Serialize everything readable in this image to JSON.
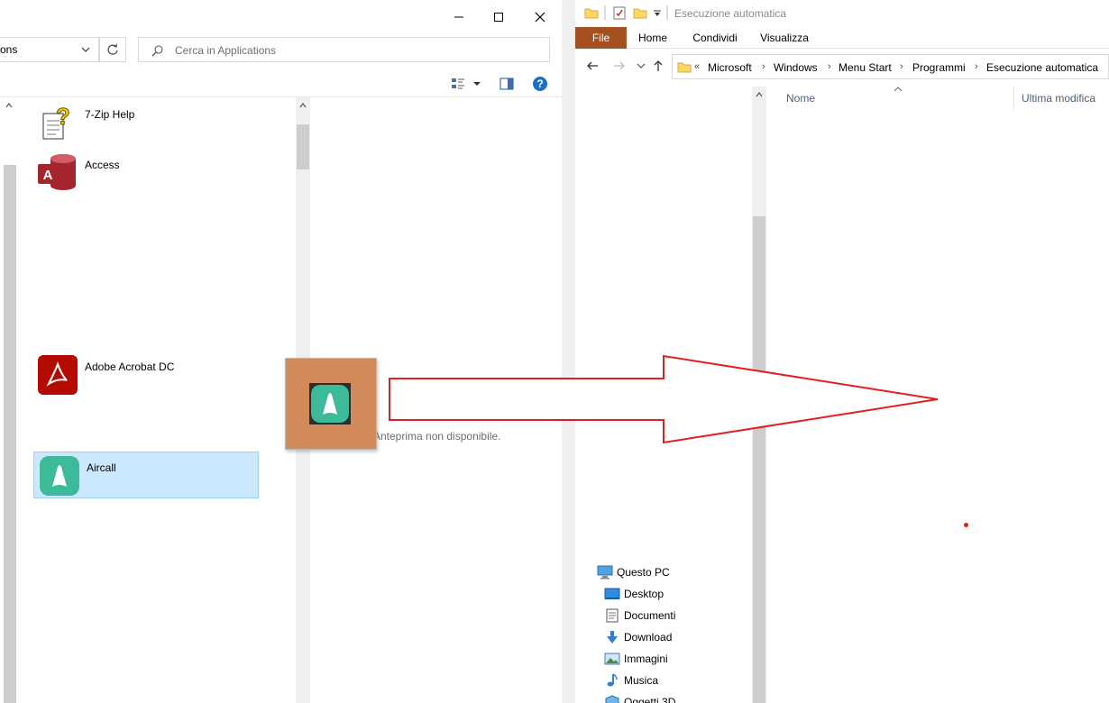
{
  "left_window": {
    "address_fragment": "ons",
    "search_placeholder": "Cerca in Applications",
    "files": [
      {
        "label": "7-Zip Help",
        "icon": "help-file-icon"
      },
      {
        "label": "Access",
        "icon": "access-icon"
      },
      {
        "label": "Adobe Acrobat DC",
        "icon": "acrobat-icon"
      },
      {
        "label": "Aircall",
        "icon": "aircall-icon",
        "selected": true
      }
    ],
    "preview_text": "Anteprima non disponibile."
  },
  "right_window": {
    "title": "Esecuzione automatica",
    "ribbon_tabs": [
      "File",
      "Home",
      "Condividi",
      "Visualizza"
    ],
    "breadcrumb_overflow": "«",
    "breadcrumb": [
      "Microsoft",
      "Windows",
      "Menu Start",
      "Programmi",
      "Esecuzione automatica"
    ],
    "columns": [
      "Nome",
      "Ultima modifica"
    ],
    "nav": {
      "root": "Questo PC",
      "items": [
        {
          "label": "Desktop",
          "icon": "desktop-icon"
        },
        {
          "label": "Documenti",
          "icon": "documents-icon"
        },
        {
          "label": "Download",
          "icon": "download-icon"
        },
        {
          "label": "Immagini",
          "icon": "pictures-icon"
        },
        {
          "label": "Musica",
          "icon": "music-icon"
        },
        {
          "label": "Oggetti 3D",
          "icon": "objects-3d-icon"
        }
      ]
    }
  },
  "colors": {
    "file_tab": "#a4501f",
    "selection": "#cce8ff",
    "drag_ghost": "#d28a5a",
    "arrow": "#e02020",
    "aircall": "#3cba9a"
  }
}
